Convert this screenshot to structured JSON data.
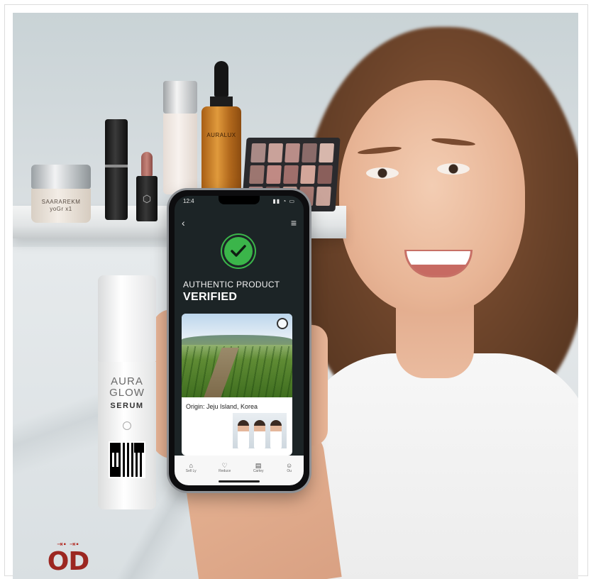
{
  "shelf_products": {
    "jar_label_line1": "SAARAREKM",
    "jar_label_line2": "yoGr x1",
    "dropper_label": "AURALUX"
  },
  "aura_bottle": {
    "line1": "AURA",
    "line2": "GLOW",
    "line3": "SERUM"
  },
  "phone": {
    "time": "12:4",
    "back_icon": "chevron-left-icon",
    "menu_icon": "hamburger-menu-icon",
    "verified_icon": "check-circle-icon",
    "headline": "AUTHENTIC PRODUCT",
    "status": "VERIFIED",
    "origin_text": "Origin: Jeju Island, Korea",
    "tabs": [
      {
        "icon": "home-icon",
        "label": "Sell Ly"
      },
      {
        "icon": "heart-icon",
        "label": "Reduce"
      },
      {
        "icon": "list-icon",
        "label": "Cartey"
      },
      {
        "icon": "user-icon",
        "label": "Ou"
      }
    ],
    "accent": "#3bb54a"
  },
  "logo": {
    "text": "OD",
    "color": "#9c2721"
  },
  "palette_colors": [
    "#a98a86",
    "#c9a29a",
    "#b98d88",
    "#8a6b69",
    "#d7b7ac",
    "#9c7670",
    "#c08a84",
    "#a06f6b",
    "#d3a69a",
    "#8a5f5b",
    "#b08784",
    "#7b5653",
    "#c49d92",
    "#a77a73",
    "#caa49a"
  ]
}
